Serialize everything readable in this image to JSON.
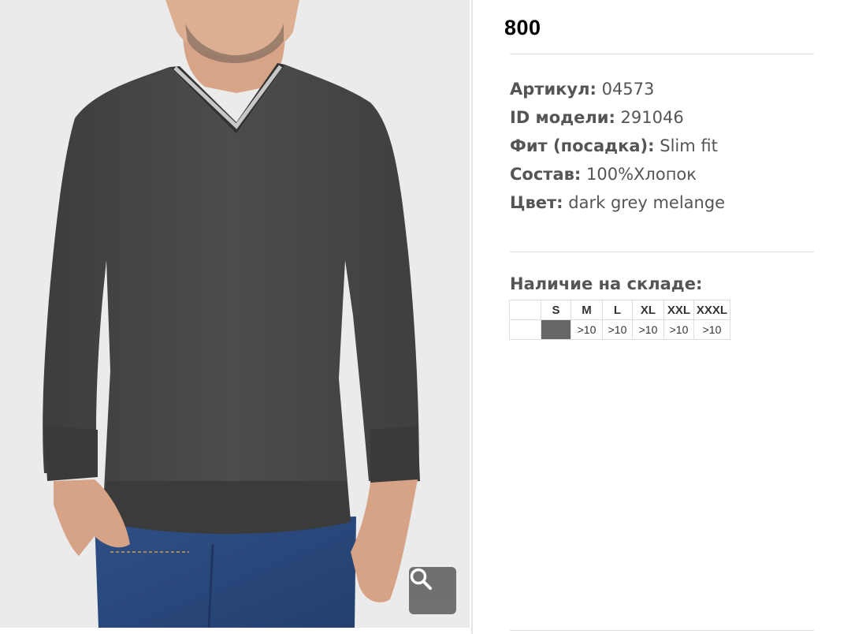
{
  "product": {
    "price": "800",
    "specs": [
      {
        "key": "Артикул:",
        "value": " 04573"
      },
      {
        "key": "ID модели:",
        "value": " 291046"
      },
      {
        "key": "Фит (посадка):",
        "value": " Slim fit"
      },
      {
        "key": "Состав:",
        "value": " 100%Хлопок"
      },
      {
        "key": "Цвет:",
        "value": " dark grey melange"
      }
    ],
    "stock": {
      "heading": "Наличие на складе:",
      "sizes": [
        "S",
        "M",
        "L",
        "XL",
        "XXL",
        "XXXL"
      ],
      "quantities": [
        "",
        ">10",
        ">10",
        ">10",
        ">10",
        ">10"
      ],
      "unavailable_color": "#666666"
    }
  },
  "photo": {
    "image_icon": "product-photo",
    "zoom_icon": "magnifier-icon",
    "colors": {
      "background": "#ebebeb",
      "sweater": "#4a4a4a",
      "jeans": "#2c4a7e",
      "skin": "#d9a58a",
      "zoom_button": "#666666"
    }
  }
}
